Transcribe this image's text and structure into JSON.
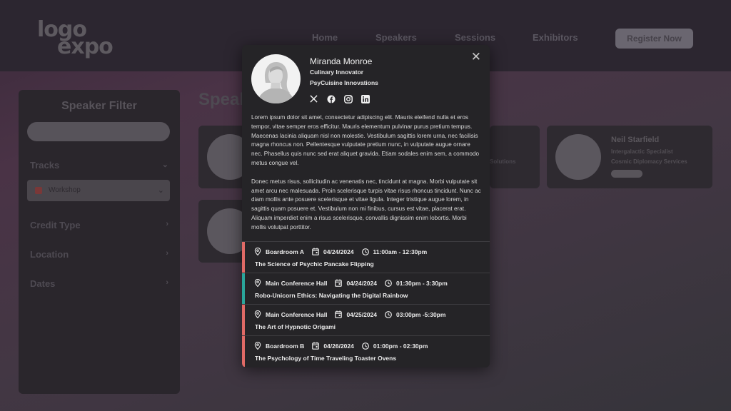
{
  "background": {
    "logo_line1": "logo",
    "logo_line2": "expo",
    "nav": [
      "Home",
      "Speakers",
      "Sessions",
      "Exhibitors"
    ],
    "register_label": "Register Now",
    "sidebar": {
      "title": "Speaker Filter",
      "tracks_label": "Tracks",
      "workshop_label": "Workshop",
      "credit_type_label": "Credit Type",
      "location_label": "Location",
      "dates_label": "Dates"
    },
    "heading_fragment": "Speak",
    "card_fragment_org": "Solutions",
    "neil": {
      "name": "Neil Starfield",
      "role": "Intergalactic Specialist",
      "org": "Cosmic Diplomacy Services"
    }
  },
  "modal": {
    "speaker": {
      "name": "Miranda Monroe",
      "role": "Culinary Innovator",
      "org": "PsyCuisine Innovations"
    },
    "social_icons": [
      "x-icon",
      "facebook-icon",
      "instagram-icon",
      "linkedin-icon"
    ],
    "bio_p1": "Lorem ipsum dolor sit amet, consectetur adipiscing elit. Mauris eleifend nulla et eros tempor, vitae semper eros efficitur. Mauris elementum pulvinar purus pretium tempus. Maecenas lacinia aliquam nisl non molestie. Vestibulum sagittis lorem urna, nec facilisis magna rhoncus non. Pellentesque vulputate pretium nunc, in vulputate augue ornare nec. Phasellus quis nunc sed erat aliquet gravida. Etiam sodales enim sem, a commodo metus congue vel.",
    "bio_p2": "Donec metus risus, sollicitudin ac venenatis nec, tincidunt at magna. Morbi vulputate sit amet arcu nec malesuada. Proin scelerisque turpis vitae risus rhoncus tincidunt. Nunc ac diam mollis ante posuere scelerisque et vitae ligula. Integer tristique augue lorem, in sagittis quam posuere et. Vestibulum non mi finibus, cursus est vitae, placerat erat. Aliquam imperdiet enim a risus scelerisque, convallis dignissim enim lobortis. Morbi mollis volutpat porttitor.",
    "sessions": [
      {
        "room": "Boardroom A",
        "date": "04/24/2024",
        "time": "11:00am - 12:30pm",
        "title": "The Science of Psychic Pancake Flipping",
        "color": "#e06a66"
      },
      {
        "room": "Main Conference Hall",
        "date": "04/24/2024",
        "time": "01:30pm - 3:30pm",
        "title": "Robo-Unicorn Ethics: Navigating the Digital Rainbow",
        "color": "#2aa59a"
      },
      {
        "room": "Main Conference Hall",
        "date": "04/25/2024",
        "time": "03:00pm -5:30pm",
        "title": "The Art of Hypnotic Origami",
        "color": "#e06a66"
      },
      {
        "room": "Boardroom B",
        "date": "04/26/2024",
        "time": "01:00pm - 02:30pm",
        "title": "The Psychology of Time Traveling Toaster Ovens",
        "color": "#e06a66"
      }
    ]
  }
}
